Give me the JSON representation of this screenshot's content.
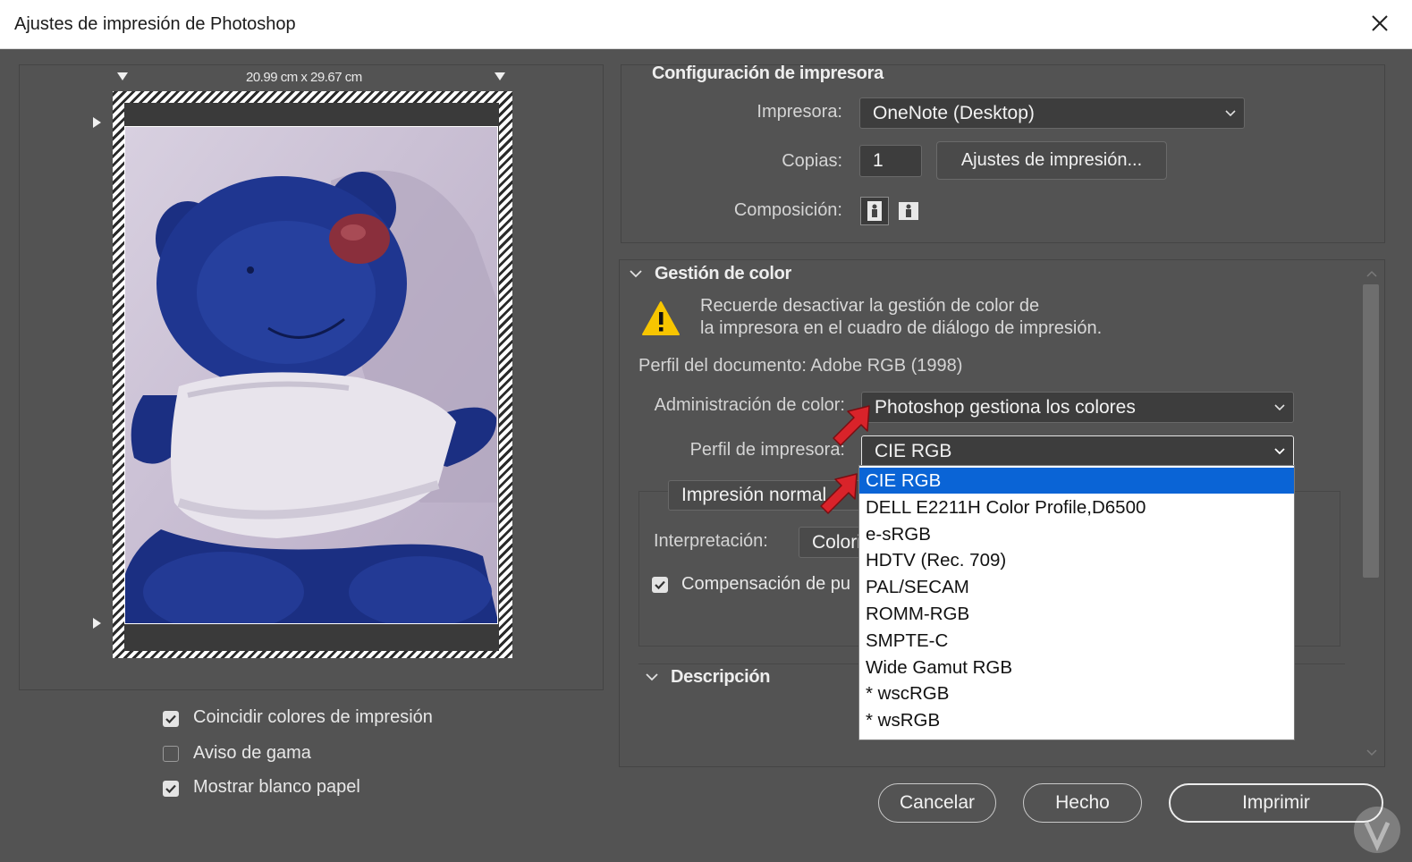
{
  "window": {
    "title": "Ajustes de impresión de Photoshop"
  },
  "preview": {
    "paper_size": "20.99 cm x 29.67 cm",
    "checkboxes": [
      {
        "label": "Coincidir colores de impresión",
        "checked": true
      },
      {
        "label": "Aviso de gama",
        "checked": false
      },
      {
        "label": "Mostrar blanco papel",
        "checked": true
      }
    ]
  },
  "printer_setup": {
    "title": "Configuración de impresora",
    "printer_label": "Impresora:",
    "printer_value": "OneNote (Desktop)",
    "copies_label": "Copias:",
    "copies_value": "1",
    "print_settings_button": "Ajustes de impresión...",
    "layout_label": "Composición:"
  },
  "color_management": {
    "title": "Gestión de color",
    "warning_line1": "Recuerde desactivar la gestión de color de",
    "warning_line2": "la impresora en el cuadro de diálogo de impresión.",
    "document_profile": "Perfil del documento: Adobe RGB (1998)",
    "color_handling_label": "Administración de color:",
    "color_handling_value": "Photoshop gestiona los colores",
    "printer_profile_label": "Perfil de impresora:",
    "printer_profile_value": "CIE RGB",
    "normal_printing_value": "Impresión normal",
    "rendering_intent_label": "Interpretación:",
    "rendering_intent_value": "Colori",
    "black_point_label": "Compensación de pu",
    "black_point_checked": true
  },
  "profile_options": [
    "CIE RGB",
    "DELL E2211H Color Profile,D6500",
    "e-sRGB",
    "HDTV (Rec. 709)",
    "PAL/SECAM",
    "ROMM-RGB",
    "SMPTE-C",
    "Wide Gamut RGB",
    "* wscRGB",
    "* wsRGB"
  ],
  "profile_selected_index": 0,
  "description": {
    "title": "Descripción"
  },
  "footer": {
    "cancel": "Cancelar",
    "done": "Hecho",
    "print": "Imprimir"
  },
  "colors": {
    "dialog_bg": "#535353",
    "selection_blue": "#0a64d6",
    "annotation_arrow": "#d9232a"
  }
}
